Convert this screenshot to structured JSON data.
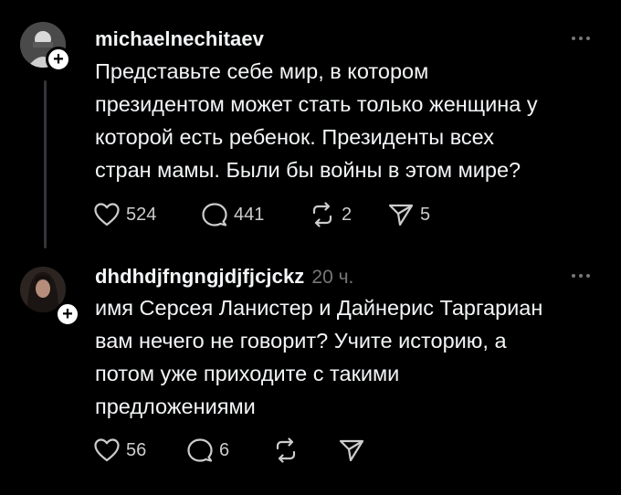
{
  "posts": [
    {
      "username": "michaelnechitaev",
      "timestamp": "",
      "text": "Представьте себе мир, в котором\nпрезидентом может стать только женщина у\nкоторой есть ребенок. Президенты всех\nстран мамы. Были бы войны в этом мире?",
      "likes": "524",
      "comments": "441",
      "reposts": "2",
      "shares": "5"
    },
    {
      "username": "dhdhdjfngngjdjfjcjckz",
      "timestamp": "20 ч.",
      "text": "имя Серсея Ланистер и Дайнерис Таргариан\nвам нечего не говорит? Учите историю, а\nпотом уже приходите с такими\nпредложениями",
      "likes": "56",
      "comments": "6",
      "reposts": "",
      "shares": ""
    }
  ],
  "icons": {
    "like": "heart-icon",
    "comment": "comment-icon",
    "repost": "repost-icon",
    "share": "share-icon",
    "more": "more-icon",
    "follow": "plus-icon"
  },
  "colors": {
    "background": "#000000",
    "text": "#f3f5f7",
    "muted": "#777777",
    "icon": "#cccccc"
  }
}
